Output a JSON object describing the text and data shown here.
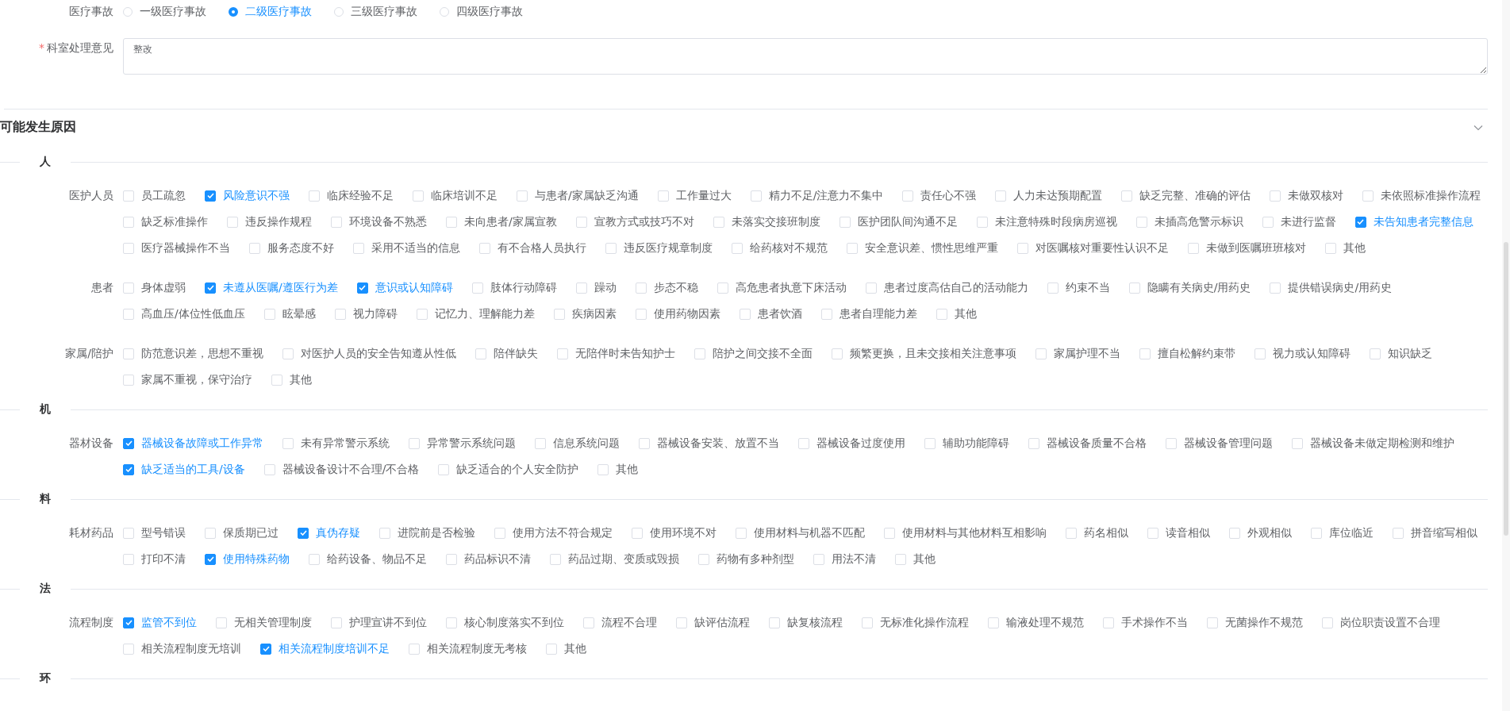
{
  "accident": {
    "label": "医疗事故",
    "options": [
      {
        "label": "一级医疗事故",
        "selected": false
      },
      {
        "label": "二级医疗事故",
        "selected": true
      },
      {
        "label": "三级医疗事故",
        "selected": false
      },
      {
        "label": "四级医疗事故",
        "selected": false
      }
    ]
  },
  "opinion": {
    "required_mark": "*",
    "label": "科室处理意见",
    "value": "整改"
  },
  "causes": {
    "title": "可能发生原因",
    "expanded": true,
    "sections": [
      {
        "title": "人",
        "groups": [
          {
            "label": "医护人员",
            "options": [
              {
                "label": "员工疏忽",
                "checked": false
              },
              {
                "label": "风险意识不强",
                "checked": true
              },
              {
                "label": "临床经验不足",
                "checked": false
              },
              {
                "label": "临床培训不足",
                "checked": false
              },
              {
                "label": "与患者/家属缺乏沟通",
                "checked": false
              },
              {
                "label": "工作量过大",
                "checked": false
              },
              {
                "label": "精力不足/注意力不集中",
                "checked": false
              },
              {
                "label": "责任心不强",
                "checked": false
              },
              {
                "label": "人力未达预期配置",
                "checked": false
              },
              {
                "label": "缺乏完整、准确的评估",
                "checked": false
              },
              {
                "label": "未做双核对",
                "checked": false
              },
              {
                "label": "未依照标准操作流程",
                "checked": false
              },
              {
                "label": "缺乏标准操作",
                "checked": false
              },
              {
                "label": "违反操作规程",
                "checked": false
              },
              {
                "label": "环境设备不熟悉",
                "checked": false
              },
              {
                "label": "未向患者/家属宣教",
                "checked": false
              },
              {
                "label": "宣教方式或技巧不对",
                "checked": false
              },
              {
                "label": "未落实交接班制度",
                "checked": false
              },
              {
                "label": "医护团队间沟通不足",
                "checked": false
              },
              {
                "label": "未注意特殊时段病房巡视",
                "checked": false
              },
              {
                "label": "未插高危警示标识",
                "checked": false
              },
              {
                "label": "未进行监督",
                "checked": false
              },
              {
                "label": "未告知患者完整信息",
                "checked": true
              },
              {
                "label": "医疗器械操作不当",
                "checked": false
              },
              {
                "label": "服务态度不好",
                "checked": false
              },
              {
                "label": "采用不适当的信息",
                "checked": false
              },
              {
                "label": "有不合格人员执行",
                "checked": false
              },
              {
                "label": "违反医疗规章制度",
                "checked": false
              },
              {
                "label": "给药核对不规范",
                "checked": false
              },
              {
                "label": "安全意识差、惯性思维严重",
                "checked": false
              },
              {
                "label": "对医嘱核对重要性认识不足",
                "checked": false
              },
              {
                "label": "未做到医嘱班班核对",
                "checked": false
              },
              {
                "label": "其他",
                "checked": false
              }
            ]
          },
          {
            "label": "患者",
            "options": [
              {
                "label": "身体虚弱",
                "checked": false
              },
              {
                "label": "未遵从医嘱/遵医行为差",
                "checked": true
              },
              {
                "label": "意识或认知障碍",
                "checked": true
              },
              {
                "label": "肢体行动障碍",
                "checked": false
              },
              {
                "label": "躁动",
                "checked": false
              },
              {
                "label": "步态不稳",
                "checked": false
              },
              {
                "label": "高危患者执意下床活动",
                "checked": false
              },
              {
                "label": "患者过度高估自己的活动能力",
                "checked": false
              },
              {
                "label": "约束不当",
                "checked": false
              },
              {
                "label": "隐瞒有关病史/用药史",
                "checked": false
              },
              {
                "label": "提供错误病史/用药史",
                "checked": false
              },
              {
                "label": "高血压/体位性低血压",
                "checked": false
              },
              {
                "label": "眩晕感",
                "checked": false
              },
              {
                "label": "视力障碍",
                "checked": false
              },
              {
                "label": "记忆力、理解能力差",
                "checked": false
              },
              {
                "label": "疾病因素",
                "checked": false
              },
              {
                "label": "使用药物因素",
                "checked": false
              },
              {
                "label": "患者饮酒",
                "checked": false
              },
              {
                "label": "患者自理能力差",
                "checked": false
              },
              {
                "label": "其他",
                "checked": false
              }
            ]
          },
          {
            "label": "家属/陪护",
            "options": [
              {
                "label": "防范意识差，思想不重视",
                "checked": false
              },
              {
                "label": "对医护人员的安全告知遵从性低",
                "checked": false
              },
              {
                "label": "陪伴缺失",
                "checked": false
              },
              {
                "label": "无陪伴时未告知护士",
                "checked": false
              },
              {
                "label": "陪护之间交接不全面",
                "checked": false
              },
              {
                "label": "频繁更换，且未交接相关注意事项",
                "checked": false
              },
              {
                "label": "家属护理不当",
                "checked": false
              },
              {
                "label": "擅自松解约束带",
                "checked": false
              },
              {
                "label": "视力或认知障碍",
                "checked": false
              },
              {
                "label": "知识缺乏",
                "checked": false
              },
              {
                "label": "家属不重视，保守治疗",
                "checked": false
              },
              {
                "label": "其他",
                "checked": false
              }
            ]
          }
        ]
      },
      {
        "title": "机",
        "groups": [
          {
            "label": "器材设备",
            "options": [
              {
                "label": "器械设备故障或工作异常",
                "checked": true
              },
              {
                "label": "未有异常警示系统",
                "checked": false
              },
              {
                "label": "异常警示系统问题",
                "checked": false
              },
              {
                "label": "信息系统问题",
                "checked": false
              },
              {
                "label": "器械设备安装、放置不当",
                "checked": false
              },
              {
                "label": "器械设备过度使用",
                "checked": false
              },
              {
                "label": "辅助功能障碍",
                "checked": false
              },
              {
                "label": "器械设备质量不合格",
                "checked": false
              },
              {
                "label": "器械设备管理问题",
                "checked": false
              },
              {
                "label": "器械设备未做定期检测和维护",
                "checked": false
              },
              {
                "label": "缺乏适当的工具/设备",
                "checked": true
              },
              {
                "label": "器械设备设计不合理/不合格",
                "checked": false
              },
              {
                "label": "缺乏适合的个人安全防护",
                "checked": false
              },
              {
                "label": "其他",
                "checked": false
              }
            ]
          }
        ]
      },
      {
        "title": "料",
        "groups": [
          {
            "label": "耗材药品",
            "options": [
              {
                "label": "型号错误",
                "checked": false
              },
              {
                "label": "保质期已过",
                "checked": false
              },
              {
                "label": "真伪存疑",
                "checked": true
              },
              {
                "label": "进院前是否检验",
                "checked": false
              },
              {
                "label": "使用方法不符合规定",
                "checked": false
              },
              {
                "label": "使用环境不对",
                "checked": false
              },
              {
                "label": "使用材料与机器不匹配",
                "checked": false
              },
              {
                "label": "使用材料与其他材料互相影响",
                "checked": false
              },
              {
                "label": "药名相似",
                "checked": false
              },
              {
                "label": "读音相似",
                "checked": false
              },
              {
                "label": "外观相似",
                "checked": false
              },
              {
                "label": "库位临近",
                "checked": false
              },
              {
                "label": "拼音缩写相似",
                "checked": false
              },
              {
                "label": "打印不清",
                "checked": false
              },
              {
                "label": "使用特殊药物",
                "checked": true
              },
              {
                "label": "给药设备、物品不足",
                "checked": false
              },
              {
                "label": "药品标识不清",
                "checked": false
              },
              {
                "label": "药品过期、变质或毁损",
                "checked": false
              },
              {
                "label": "药物有多种剂型",
                "checked": false
              },
              {
                "label": "用法不清",
                "checked": false
              },
              {
                "label": "其他",
                "checked": false
              }
            ]
          }
        ]
      },
      {
        "title": "法",
        "groups": [
          {
            "label": "流程制度",
            "options": [
              {
                "label": "监管不到位",
                "checked": true
              },
              {
                "label": "无相关管理制度",
                "checked": false
              },
              {
                "label": "护理宣讲不到位",
                "checked": false
              },
              {
                "label": "核心制度落实不到位",
                "checked": false
              },
              {
                "label": "流程不合理",
                "checked": false
              },
              {
                "label": "缺评估流程",
                "checked": false
              },
              {
                "label": "缺复核流程",
                "checked": false
              },
              {
                "label": "无标准化操作流程",
                "checked": false
              },
              {
                "label": "输液处理不规范",
                "checked": false
              },
              {
                "label": "手术操作不当",
                "checked": false
              },
              {
                "label": "无菌操作不规范",
                "checked": false
              },
              {
                "label": "岗位职责设置不合理",
                "checked": false
              },
              {
                "label": "相关流程制度无培训",
                "checked": false
              },
              {
                "label": "相关流程制度培训不足",
                "checked": true
              },
              {
                "label": "相关流程制度无考核",
                "checked": false
              },
              {
                "label": "其他",
                "checked": false
              }
            ]
          }
        ]
      },
      {
        "title": "环"
      }
    ]
  }
}
